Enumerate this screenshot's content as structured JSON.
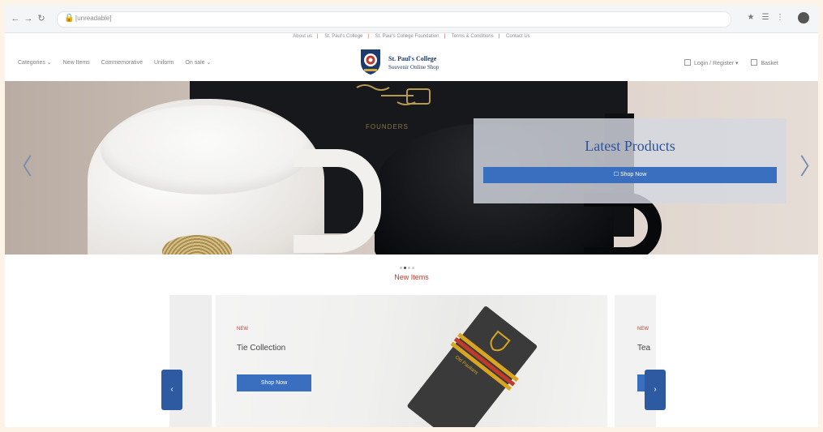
{
  "browser": {
    "back_icon": "←",
    "forward_icon": "→",
    "reload_icon": "↻",
    "lock_icon": "🔒",
    "url": "[unreadable]",
    "extension_icons": [
      "★",
      "☰",
      "⋮"
    ]
  },
  "top_links": [
    "About us",
    "St. Paul's College",
    "St. Paul's College Foundation",
    "Terms & Conditions",
    "Contact Us"
  ],
  "main_nav": [
    "Categories ⌄",
    "New Items",
    "Commemorative",
    "Uniform",
    "On sale ⌄"
  ],
  "logo": {
    "title": "St. Paul's College",
    "subtitle": "Souvenir Online Shop"
  },
  "right_nav": {
    "account_label": "Login / Register ▾",
    "cart_label": "Basket"
  },
  "hero": {
    "title": "Latest Products",
    "button_label": "☐ Shop Now",
    "prev_icon": "〈",
    "next_icon": "〉",
    "print_text": "FOUNDERS"
  },
  "slides": {
    "count": 4,
    "active": 1
  },
  "new_items": {
    "title": "New Items",
    "card": {
      "tag": "NEW",
      "title": "Tie Collection",
      "button_label": "Shop Now",
      "tie_print": "Old Paulians"
    },
    "next_card": {
      "tag": "NEW",
      "title": "Tea"
    },
    "prev_icon": "‹",
    "next_icon": "›"
  },
  "colors": {
    "accent_blue": "#3a6fbf",
    "brand_navy": "#1d3a6e",
    "accent_red": "#c0392b"
  }
}
